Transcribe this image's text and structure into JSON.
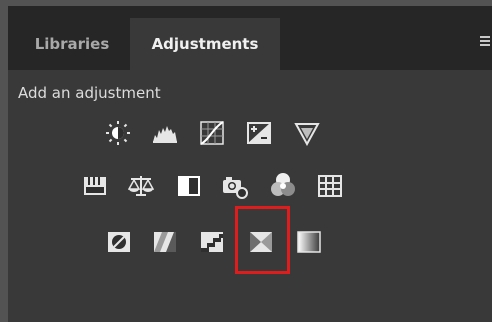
{
  "tabs": [
    {
      "label": "Libraries",
      "active": false
    },
    {
      "label": "Adjustments",
      "active": true
    }
  ],
  "panel": {
    "heading": "Add an adjustment"
  },
  "icons": {
    "row1": [
      "brightness-contrast-icon",
      "levels-icon",
      "curves-icon",
      "exposure-icon",
      "vibrance-icon"
    ],
    "row2": [
      "hue-saturation-icon",
      "color-balance-icon",
      "black-white-icon",
      "photo-filter-icon",
      "channel-mixer-icon",
      "color-lookup-icon"
    ],
    "row3": [
      "invert-icon",
      "posterize-icon",
      "threshold-icon",
      "selective-color-icon",
      "gradient-map-icon"
    ]
  },
  "colors": {
    "panel_bg": "#393939",
    "tab_bar_bg": "#262626",
    "highlight": "#e01d1d"
  }
}
